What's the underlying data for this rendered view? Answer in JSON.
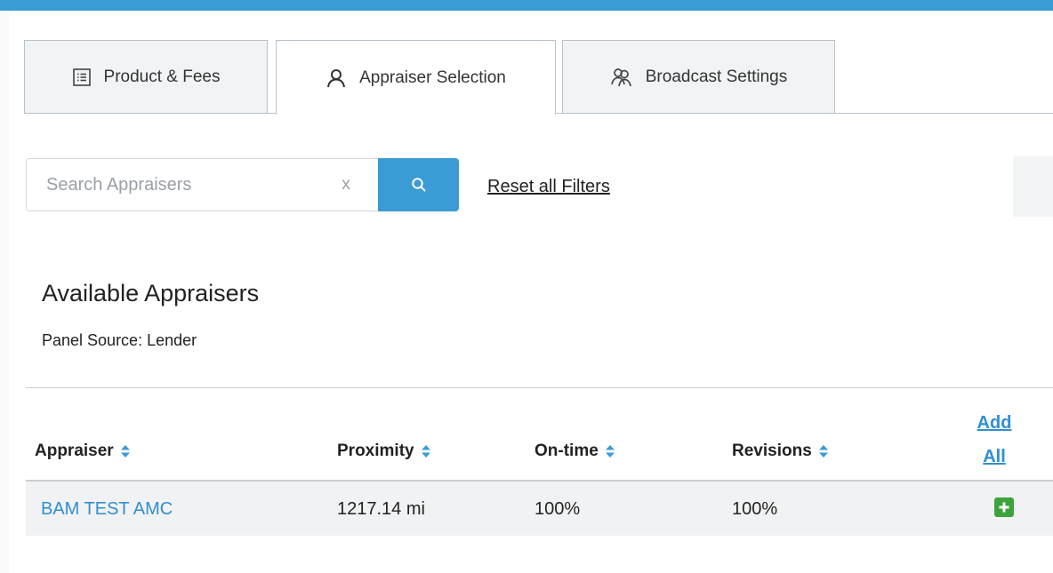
{
  "tabs": [
    {
      "label": "Product & Fees",
      "icon": "list-icon",
      "active": false
    },
    {
      "label": "Appraiser Selection",
      "icon": "user-icon",
      "active": true
    },
    {
      "label": "Broadcast Settings",
      "icon": "users-icon",
      "active": false
    }
  ],
  "search": {
    "placeholder": "Search Appraisers",
    "clear_label": "x",
    "button_icon": "search-icon"
  },
  "filters": {
    "reset_label": "Reset all Filters"
  },
  "section": {
    "title": "Available Appraisers",
    "panel_source": "Panel Source: Lender"
  },
  "table": {
    "columns": [
      "Appraiser",
      "Proximity",
      "On-time",
      "Revisions"
    ],
    "add_all_line1": "Add",
    "add_all_line2": "All",
    "rows": [
      {
        "appraiser": "BAM TEST AMC",
        "proximity": "1217.14 mi",
        "ontime": "100%",
        "revisions": "100%"
      }
    ]
  },
  "colors": {
    "accent": "#3a9bd5",
    "link": "#2f8fd0",
    "add_button": "#3da33d"
  }
}
